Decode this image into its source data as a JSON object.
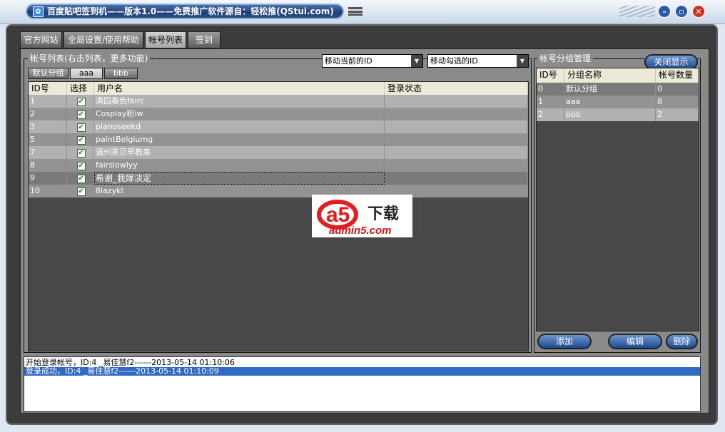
{
  "window": {
    "title": "百度贴吧签到机——版本1.0——免费推广软件源自：轻松推(QStui.com)"
  },
  "tabs": [
    "官方网站",
    "全局设置/使用帮助",
    "帐号列表",
    "签到"
  ],
  "account_list": {
    "group_label": "帐号列表(右击列表，更多功能)",
    "move_current": "移动当前的ID",
    "move_checked": "移动勾选的ID",
    "group_tabs": [
      "默认分组",
      "aaa",
      "bbb"
    ],
    "columns": [
      "ID号",
      "选择",
      "用户名",
      "登录状态"
    ],
    "rows": [
      {
        "id": "1",
        "checked": true,
        "username": "满园春色fairc",
        "status": ""
      },
      {
        "id": "2",
        "checked": true,
        "username": "Cosplay粉iw",
        "status": ""
      },
      {
        "id": "3",
        "checked": true,
        "username": "pianoseekd",
        "status": ""
      },
      {
        "id": "5",
        "checked": true,
        "username": "paintBelgiumg",
        "status": ""
      },
      {
        "id": "7",
        "checked": true,
        "username": "温州英贝早教美",
        "status": ""
      },
      {
        "id": "8",
        "checked": true,
        "username": "fairslowlyy",
        "status": ""
      },
      {
        "id": "9",
        "checked": true,
        "username": "希谢_我嫁淡定",
        "status": ""
      },
      {
        "id": "10",
        "checked": true,
        "username": "8lazykl",
        "status": ""
      }
    ]
  },
  "group_manage": {
    "label": "帐号分组管理",
    "close_button": "关闭显示",
    "columns": [
      "ID号",
      "分组名称",
      "帐号数量"
    ],
    "rows": [
      {
        "id": "0",
        "name": "默认分组",
        "count": "0"
      },
      {
        "id": "1",
        "name": "aaa",
        "count": "8"
      },
      {
        "id": "2",
        "name": "bbb",
        "count": "2"
      }
    ],
    "add": "添加",
    "edit": "编辑",
    "delete": "删除"
  },
  "log": [
    "开始登录帐号，ID:4 _易佳慧f2------2013-05-14 01:10:06",
    "登录成功，ID:4 _易佳慧f2------2013-05-14 01:10:09"
  ],
  "watermark": {
    "logo": "a5下载",
    "url": "admin5.com"
  }
}
